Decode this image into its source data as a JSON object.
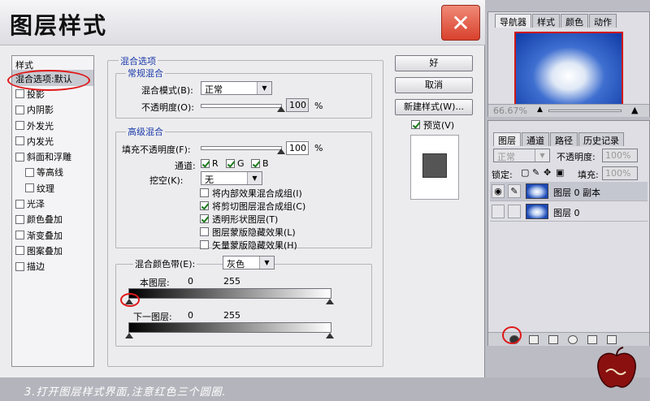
{
  "dialog": {
    "title": "图层样式",
    "close_label": "✕",
    "styles": {
      "header": "样式",
      "items": [
        {
          "label": "混合选项:默认",
          "checkbox": false,
          "selected": true,
          "indent": false
        },
        {
          "label": "投影",
          "checkbox": true,
          "checked": false,
          "indent": false
        },
        {
          "label": "内阴影",
          "checkbox": true,
          "checked": false,
          "indent": false
        },
        {
          "label": "外发光",
          "checkbox": true,
          "checked": false,
          "indent": false
        },
        {
          "label": "内发光",
          "checkbox": true,
          "checked": false,
          "indent": false
        },
        {
          "label": "斜面和浮雕",
          "checkbox": true,
          "checked": false,
          "indent": false
        },
        {
          "label": "等高线",
          "checkbox": true,
          "checked": false,
          "indent": true
        },
        {
          "label": "纹理",
          "checkbox": true,
          "checked": false,
          "indent": true
        },
        {
          "label": "光泽",
          "checkbox": true,
          "checked": false,
          "indent": false
        },
        {
          "label": "颜色叠加",
          "checkbox": true,
          "checked": false,
          "indent": false
        },
        {
          "label": "渐变叠加",
          "checkbox": true,
          "checked": false,
          "indent": false
        },
        {
          "label": "图案叠加",
          "checkbox": true,
          "checked": false,
          "indent": false
        },
        {
          "label": "描边",
          "checkbox": true,
          "checked": false,
          "indent": false
        }
      ]
    },
    "blend_options": {
      "title": "混合选项",
      "general": {
        "title": "常规混合",
        "mode_label": "混合模式(B):",
        "mode_value": "正常",
        "opacity_label": "不透明度(O):",
        "opacity_value": "100",
        "opacity_unit": "%"
      },
      "advanced": {
        "title": "高级混合",
        "fill_label": "填充不透明度(F):",
        "fill_value": "100",
        "fill_unit": "%",
        "channels_label": "通道:",
        "channels": [
          "R",
          "G",
          "B"
        ],
        "knockout_label": "挖空(K):",
        "knockout_value": "无",
        "options": [
          {
            "label": "将内部效果混合成组(I)",
            "checked": false
          },
          {
            "label": "将剪切图层混合成组(C)",
            "checked": true
          },
          {
            "label": "透明形状图层(T)",
            "checked": true
          },
          {
            "label": "图层蒙版隐藏效果(L)",
            "checked": false
          },
          {
            "label": "矢量蒙版隐藏效果(H)",
            "checked": false
          }
        ]
      },
      "blend_if": {
        "label": "混合颜色带(E):",
        "value": "灰色",
        "this_layer_label": "本图层:",
        "this_layer_min": "0",
        "this_layer_max": "255",
        "underlying_label": "下一图层:",
        "underlying_min": "0",
        "underlying_max": "255"
      }
    },
    "buttons": {
      "ok": "好",
      "cancel": "取消",
      "new_style": "新建样式(W)...",
      "preview": "预览(V)"
    }
  },
  "navigator": {
    "tabs": [
      "导航器",
      "样式",
      "颜色",
      "动作"
    ],
    "zoom": "66.67%"
  },
  "layers": {
    "tabs": [
      "图层",
      "通道",
      "路径",
      "历史记录"
    ],
    "blend_mode": "正常",
    "opacity_label": "不透明度:",
    "opacity_value": "100%",
    "lock_label": "锁定:",
    "fill_label": "填充:",
    "fill_value": "100%",
    "rows": [
      {
        "name": "图层 0 副本",
        "active": true
      },
      {
        "name": "图层 0",
        "active": false
      }
    ]
  },
  "caption": "3.打开图层样式界面,注意红色三个圆圈.",
  "colors": {
    "accent_red": "#e01818",
    "group_title_blue": "#1a3aa8",
    "close_red": "#d8412c"
  }
}
